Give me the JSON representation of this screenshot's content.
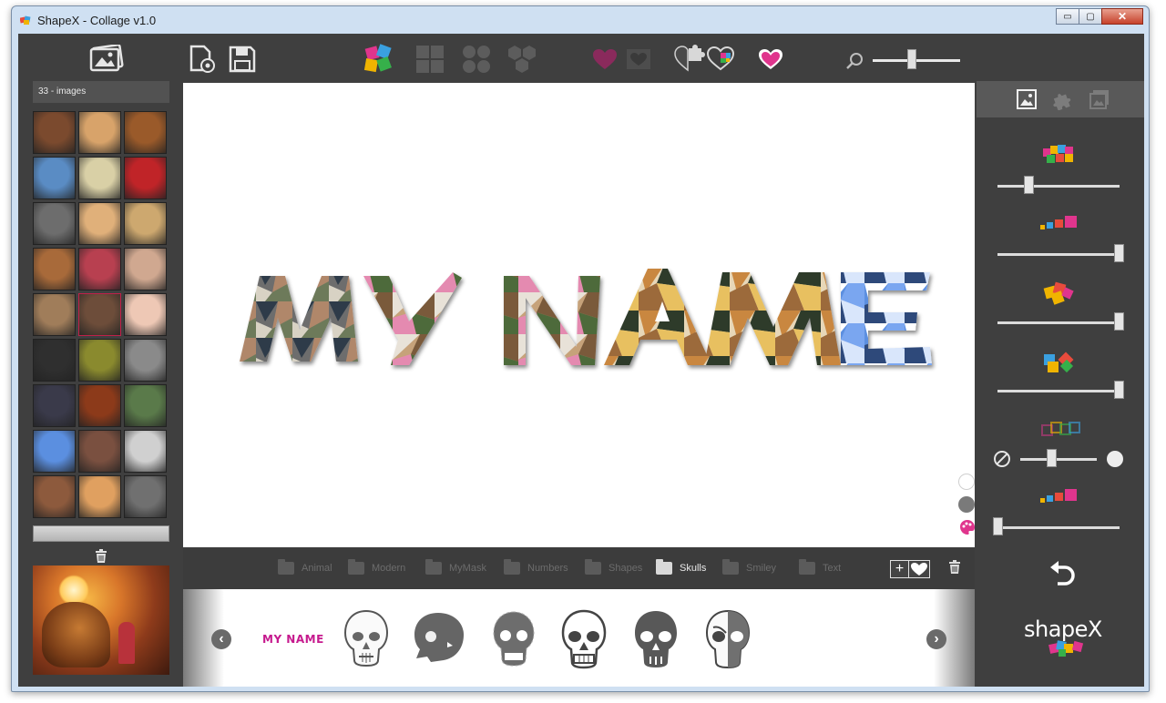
{
  "window": {
    "title": "ShapeX - Collage v1.0",
    "minimize": "▭",
    "maximize": "▢",
    "close": "✕"
  },
  "left": {
    "image_count": "33 - images"
  },
  "canvas": {
    "title_text": "MY NAME"
  },
  "categories": [
    {
      "label": "Animal",
      "active": false
    },
    {
      "label": "Modern",
      "active": false
    },
    {
      "label": "MyMask",
      "active": false
    },
    {
      "label": "Numbers",
      "active": false
    },
    {
      "label": "Shapes",
      "active": false
    },
    {
      "label": "Skulls",
      "active": true
    },
    {
      "label": "Smiley",
      "active": false
    },
    {
      "label": "Text",
      "active": false
    }
  ],
  "strip": {
    "first_item": "MY NAME",
    "prev": "‹",
    "next": "›"
  },
  "category_actions": {
    "add": "+"
  },
  "brand": {
    "logo": "shapeX"
  },
  "colors": {
    "background": "#3f3f3f",
    "accent_pink": "#e0358d",
    "logo_pink": "#c61a8e"
  },
  "thumb_colors": [
    "#7b4a2e",
    "#d8a36a",
    "#9a5a2a",
    "#5a8cc4",
    "#d9d0a6",
    "#c02428",
    "#6d6d6d",
    "#e0b07a",
    "#cda86f",
    "#a86a3a",
    "#b84050",
    "#d0a890",
    "#a07d5a",
    "#6d4d3a",
    "#eec8b5",
    "#2f2f2f",
    "#8a8a2e",
    "#8a8a8a",
    "#3a3a4a",
    "#8c3a1a",
    "#5a7a4a",
    "#5b8fe0",
    "#7a5040",
    "#d0d0d0",
    "#8d5a3d",
    "#e0a060",
    "#707070"
  ]
}
